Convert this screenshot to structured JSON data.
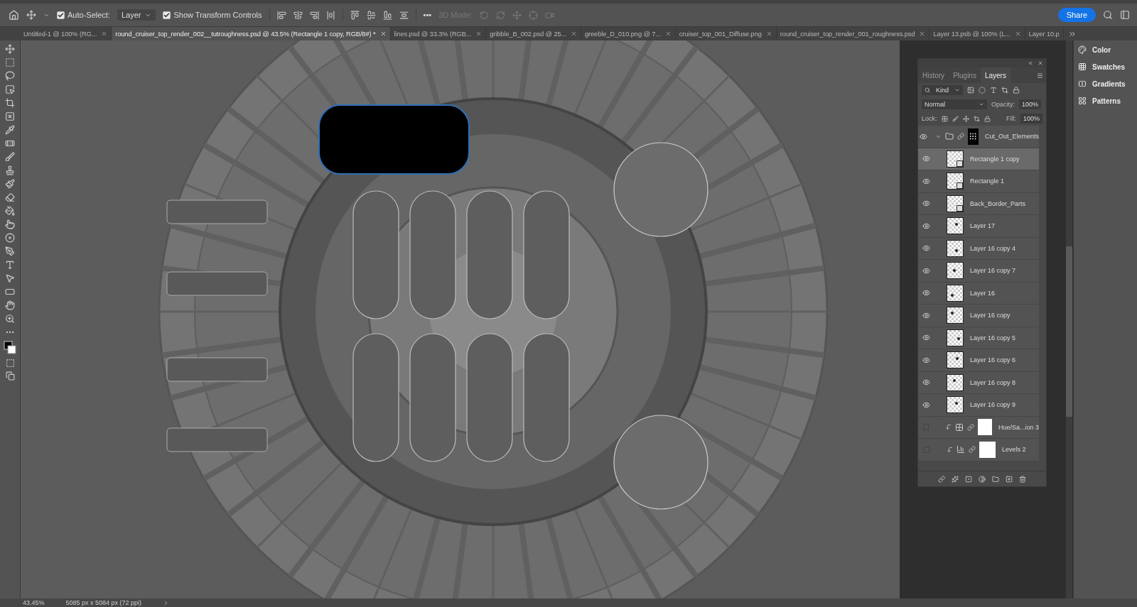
{
  "options_bar": {
    "auto_select": {
      "label": "Auto-Select:",
      "checked": true
    },
    "target": "Layer",
    "transform_controls": {
      "label": "Show Transform Controls",
      "checked": true
    },
    "more": "•••",
    "mode_label": "3D Mode:",
    "share": "Share"
  },
  "document_tabs": [
    {
      "label": "Untitled-1 @ 100% (RG...",
      "selected": false
    },
    {
      "label": "round_cruiser_top_render_002__tutroughness.psd @ 43.5% (Rectangle 1 copy, RGB/8#) *",
      "selected": true
    },
    {
      "label": "lines.psd @ 33.3% (RGB...",
      "selected": false
    },
    {
      "label": "gribble_B_002.psd @ 25...",
      "selected": false
    },
    {
      "label": "greeble_D_010.png @ 7...",
      "selected": false
    },
    {
      "label": "cruiser_top_001_Diffuse.png",
      "selected": false
    },
    {
      "label": "round_cruiser_top_render_001_roughness.psd",
      "selected": false
    },
    {
      "label": "Layer 13.psb @ 100% (L...",
      "selected": false
    },
    {
      "label": "Layer 10.p",
      "selected": false
    }
  ],
  "layers_panel": {
    "tabs": [
      {
        "label": "History",
        "selected": false
      },
      {
        "label": "Plugins",
        "selected": false
      },
      {
        "label": "Layers",
        "selected": true
      }
    ],
    "filter": "Kind",
    "blend_mode": "Normal",
    "opacity_label": "Opacity:",
    "opacity": "100%",
    "lock_label": "Lock:",
    "fill_label": "Fill:",
    "fill": "100%",
    "layers": [
      {
        "name": "Cut_Out_Elements",
        "kind": "group",
        "visible": true,
        "selected": false,
        "expanded": true,
        "children": [
          {
            "name": "Rectangle 1 copy",
            "kind": "shape",
            "visible": true,
            "selected": true
          },
          {
            "name": "Rectangle 1",
            "kind": "shape",
            "visible": true,
            "selected": false
          },
          {
            "name": "Back_Border_Parts",
            "kind": "shape",
            "visible": true,
            "selected": false
          },
          {
            "name": "Layer 17",
            "kind": "pixel",
            "visible": true,
            "selected": false
          },
          {
            "name": "Layer 16 copy 4",
            "kind": "pixel",
            "visible": true,
            "selected": false
          },
          {
            "name": "Layer 16 copy 7",
            "kind": "pixel",
            "visible": true,
            "selected": false
          },
          {
            "name": "Layer 16",
            "kind": "pixel",
            "visible": true,
            "selected": false
          },
          {
            "name": "Layer 16 copy",
            "kind": "pixel",
            "visible": true,
            "selected": false
          },
          {
            "name": "Layer 16 copy 5",
            "kind": "pixel",
            "visible": true,
            "selected": false
          },
          {
            "name": "Layer 16 copy 6",
            "kind": "pixel",
            "visible": true,
            "selected": false
          },
          {
            "name": "Layer 16 copy 8",
            "kind": "pixel",
            "visible": true,
            "selected": false
          },
          {
            "name": "Layer 16 copy 9",
            "kind": "pixel",
            "visible": true,
            "selected": false
          },
          {
            "name": "Hue/Sa...ion 3",
            "kind": "huesat",
            "visible": false,
            "selected": false
          },
          {
            "name": "Levels 2",
            "kind": "levels",
            "visible": false,
            "selected": false
          }
        ]
      }
    ]
  },
  "dock": [
    {
      "label": "Color",
      "kind": "color"
    },
    {
      "label": "Swatches",
      "kind": "swatches"
    },
    {
      "label": "Gradients",
      "kind": "gradients"
    },
    {
      "label": "Patterns",
      "kind": "patterns"
    }
  ],
  "status_bar": {
    "zoom": "43.45%",
    "document_size": "5085 px x 5084 px (72 ppi)"
  }
}
